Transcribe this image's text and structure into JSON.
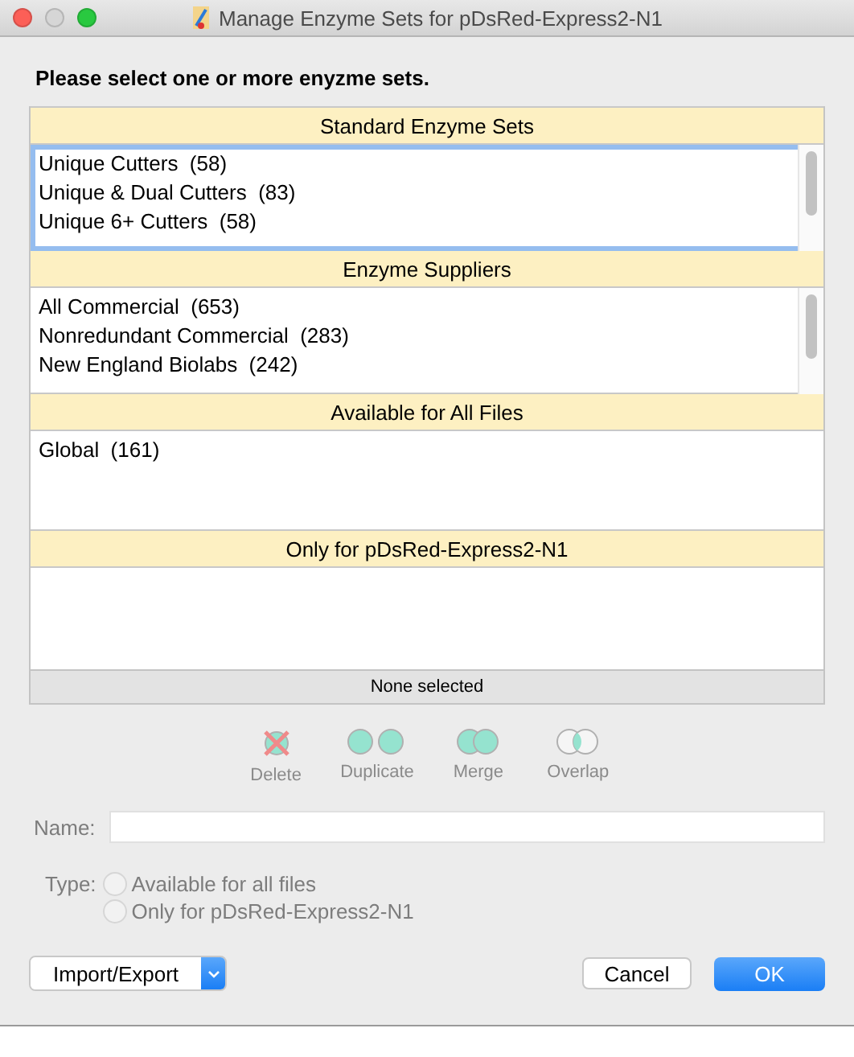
{
  "window": {
    "title": "Manage Enzyme Sets for pDsRed-Express2-N1"
  },
  "prompt": "Please select one or more enyzme sets.",
  "sections": [
    {
      "header": "Standard Enzyme Sets",
      "focused": true,
      "scrollbar": true,
      "items": [
        "Unique Cutters  (58)",
        "Unique & Dual Cutters  (83)",
        "Unique 6+ Cutters  (58)"
      ]
    },
    {
      "header": "Enzyme Suppliers",
      "focused": false,
      "scrollbar": true,
      "items": [
        "All Commercial  (653)",
        "Nonredundant Commercial  (283)",
        "New England Biolabs  (242)"
      ]
    },
    {
      "header": "Available for All Files",
      "focused": false,
      "scrollbar": false,
      "items": [
        "Global  (161)"
      ]
    },
    {
      "header": "Only for pDsRed-Express2-N1",
      "focused": false,
      "scrollbar": false
    }
  ],
  "status": "None selected",
  "actions": [
    {
      "kind": "delete",
      "label": "Delete",
      "disabled": true
    },
    {
      "kind": "duplicate",
      "label": "Duplicate",
      "disabled": true
    },
    {
      "kind": "merge",
      "label": "Merge",
      "disabled": true
    },
    {
      "kind": "overlap",
      "label": "Overlap",
      "disabled": true
    }
  ],
  "name_field": {
    "label": "Name:",
    "disabled": true
  },
  "type": {
    "label": "Type:",
    "disabled": true,
    "options": [
      {
        "label": "Available for all files",
        "selected": false
      },
      {
        "label": "Only for pDsRed-Express2-N1",
        "selected": false
      }
    ]
  },
  "buttons": {
    "import_export": "Import/Export",
    "cancel": "Cancel",
    "ok": "OK"
  }
}
